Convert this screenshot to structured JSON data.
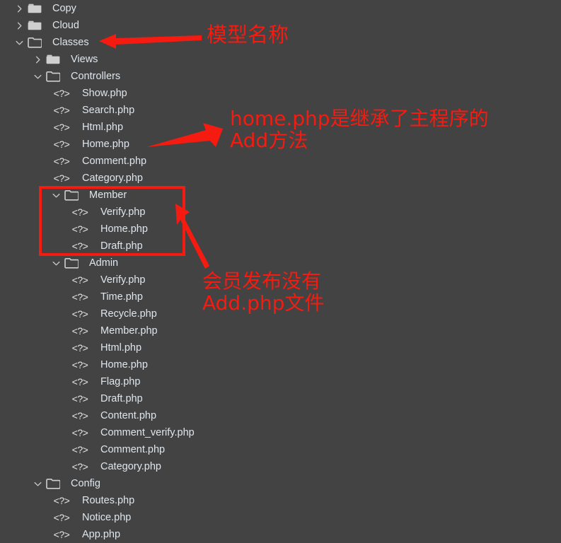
{
  "theme": {
    "background": "#434343",
    "text_color": "#dfe6ed",
    "icon_color": "#d6d6d6",
    "annotation_color": "#f51b10"
  },
  "file_tree": {
    "name": "file-explorer-tree",
    "rows": [
      {
        "label": "Copy",
        "type": "folder",
        "state": "collapsed",
        "indent": 0
      },
      {
        "label": "Cloud",
        "type": "folder",
        "state": "collapsed",
        "indent": 0
      },
      {
        "label": "Classes",
        "type": "folder",
        "state": "expanded",
        "indent": 0
      },
      {
        "label": "Views",
        "type": "folder",
        "state": "collapsed",
        "indent": 1
      },
      {
        "label": "Controllers",
        "type": "folder",
        "state": "expanded",
        "indent": 1
      },
      {
        "label": "Show.php",
        "type": "php",
        "indent": 2
      },
      {
        "label": "Search.php",
        "type": "php",
        "indent": 2
      },
      {
        "label": "Html.php",
        "type": "php",
        "indent": 2
      },
      {
        "label": "Home.php",
        "type": "php",
        "indent": 2
      },
      {
        "label": "Comment.php",
        "type": "php",
        "indent": 2
      },
      {
        "label": "Category.php",
        "type": "php",
        "indent": 2
      },
      {
        "label": "Member",
        "type": "folder",
        "state": "expanded",
        "indent": 2
      },
      {
        "label": "Verify.php",
        "type": "php",
        "indent": 3
      },
      {
        "label": "Home.php",
        "type": "php",
        "indent": 3
      },
      {
        "label": "Draft.php",
        "type": "php",
        "indent": 3
      },
      {
        "label": "Admin",
        "type": "folder",
        "state": "expanded",
        "indent": 2
      },
      {
        "label": "Verify.php",
        "type": "php",
        "indent": 3
      },
      {
        "label": "Time.php",
        "type": "php",
        "indent": 3
      },
      {
        "label": "Recycle.php",
        "type": "php",
        "indent": 3
      },
      {
        "label": "Member.php",
        "type": "php",
        "indent": 3
      },
      {
        "label": "Html.php",
        "type": "php",
        "indent": 3
      },
      {
        "label": "Home.php",
        "type": "php",
        "indent": 3
      },
      {
        "label": "Flag.php",
        "type": "php",
        "indent": 3
      },
      {
        "label": "Draft.php",
        "type": "php",
        "indent": 3
      },
      {
        "label": "Content.php",
        "type": "php",
        "indent": 3
      },
      {
        "label": "Comment_verify.php",
        "type": "php",
        "indent": 3
      },
      {
        "label": "Comment.php",
        "type": "php",
        "indent": 3
      },
      {
        "label": "Category.php",
        "type": "php",
        "indent": 3
      },
      {
        "label": "Config",
        "type": "folder",
        "state": "expanded",
        "indent": 1
      },
      {
        "label": "Routes.php",
        "type": "php",
        "indent": 2
      },
      {
        "label": "Notice.php",
        "type": "php",
        "indent": 2
      },
      {
        "label": "App.php",
        "type": "php",
        "indent": 2
      }
    ],
    "php_icon_glyph": "<?>"
  },
  "annotations": {
    "model_name": "模型名称",
    "home_inherit": "home.php是继承了主程序的\nAdd方法",
    "member_no_add": "会员发布没有\nAdd.php文件"
  }
}
